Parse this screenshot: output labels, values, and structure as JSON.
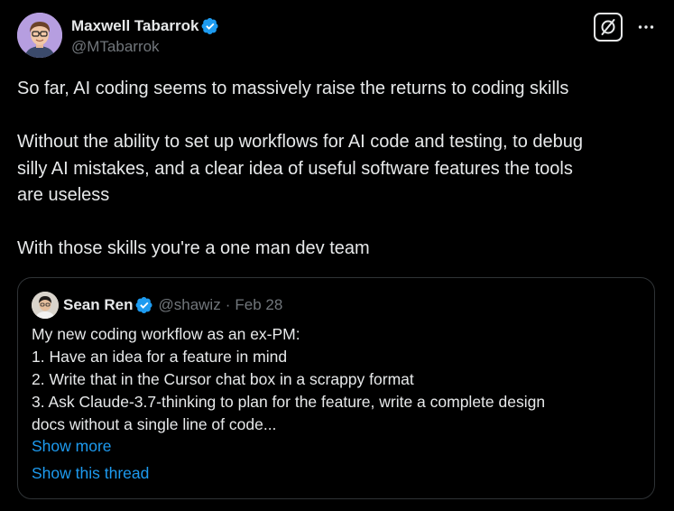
{
  "author": {
    "display_name": "Maxwell Tabarrok",
    "handle": "@MTabarrok",
    "verified_icon": "verified-badge-icon"
  },
  "actions": {
    "grok_icon": "grok-icon",
    "more_icon": "more-horizontal-icon"
  },
  "tweet": {
    "paragraphs": [
      "So far, AI coding seems to massively raise the returns to coding skills",
      "Without the ability to set up workflows for AI code and testing, to debug\nsilly AI mistakes, and a clear idea of useful software features the tools\nare useless",
      "With those skills you're a one man dev team"
    ]
  },
  "quote": {
    "display_name": "Sean Ren",
    "handle": "@shawiz",
    "separator": "·",
    "date": "Feb 28",
    "lines": [
      "My new coding workflow as an ex-PM:",
      "1. Have an idea for a feature in mind",
      "2. Write that in the Cursor chat box in a scrappy format",
      "3. Ask Claude-3.7-thinking to plan for the feature, write a complete design",
      "docs without a single line of code..."
    ],
    "show_more": "Show more",
    "show_thread": "Show this thread"
  },
  "colors": {
    "background": "#000000",
    "text": "#e7e9ea",
    "secondary_text": "#71767b",
    "link": "#1d9bf0",
    "verified": "#1d9bf0",
    "border": "#2f3336"
  }
}
